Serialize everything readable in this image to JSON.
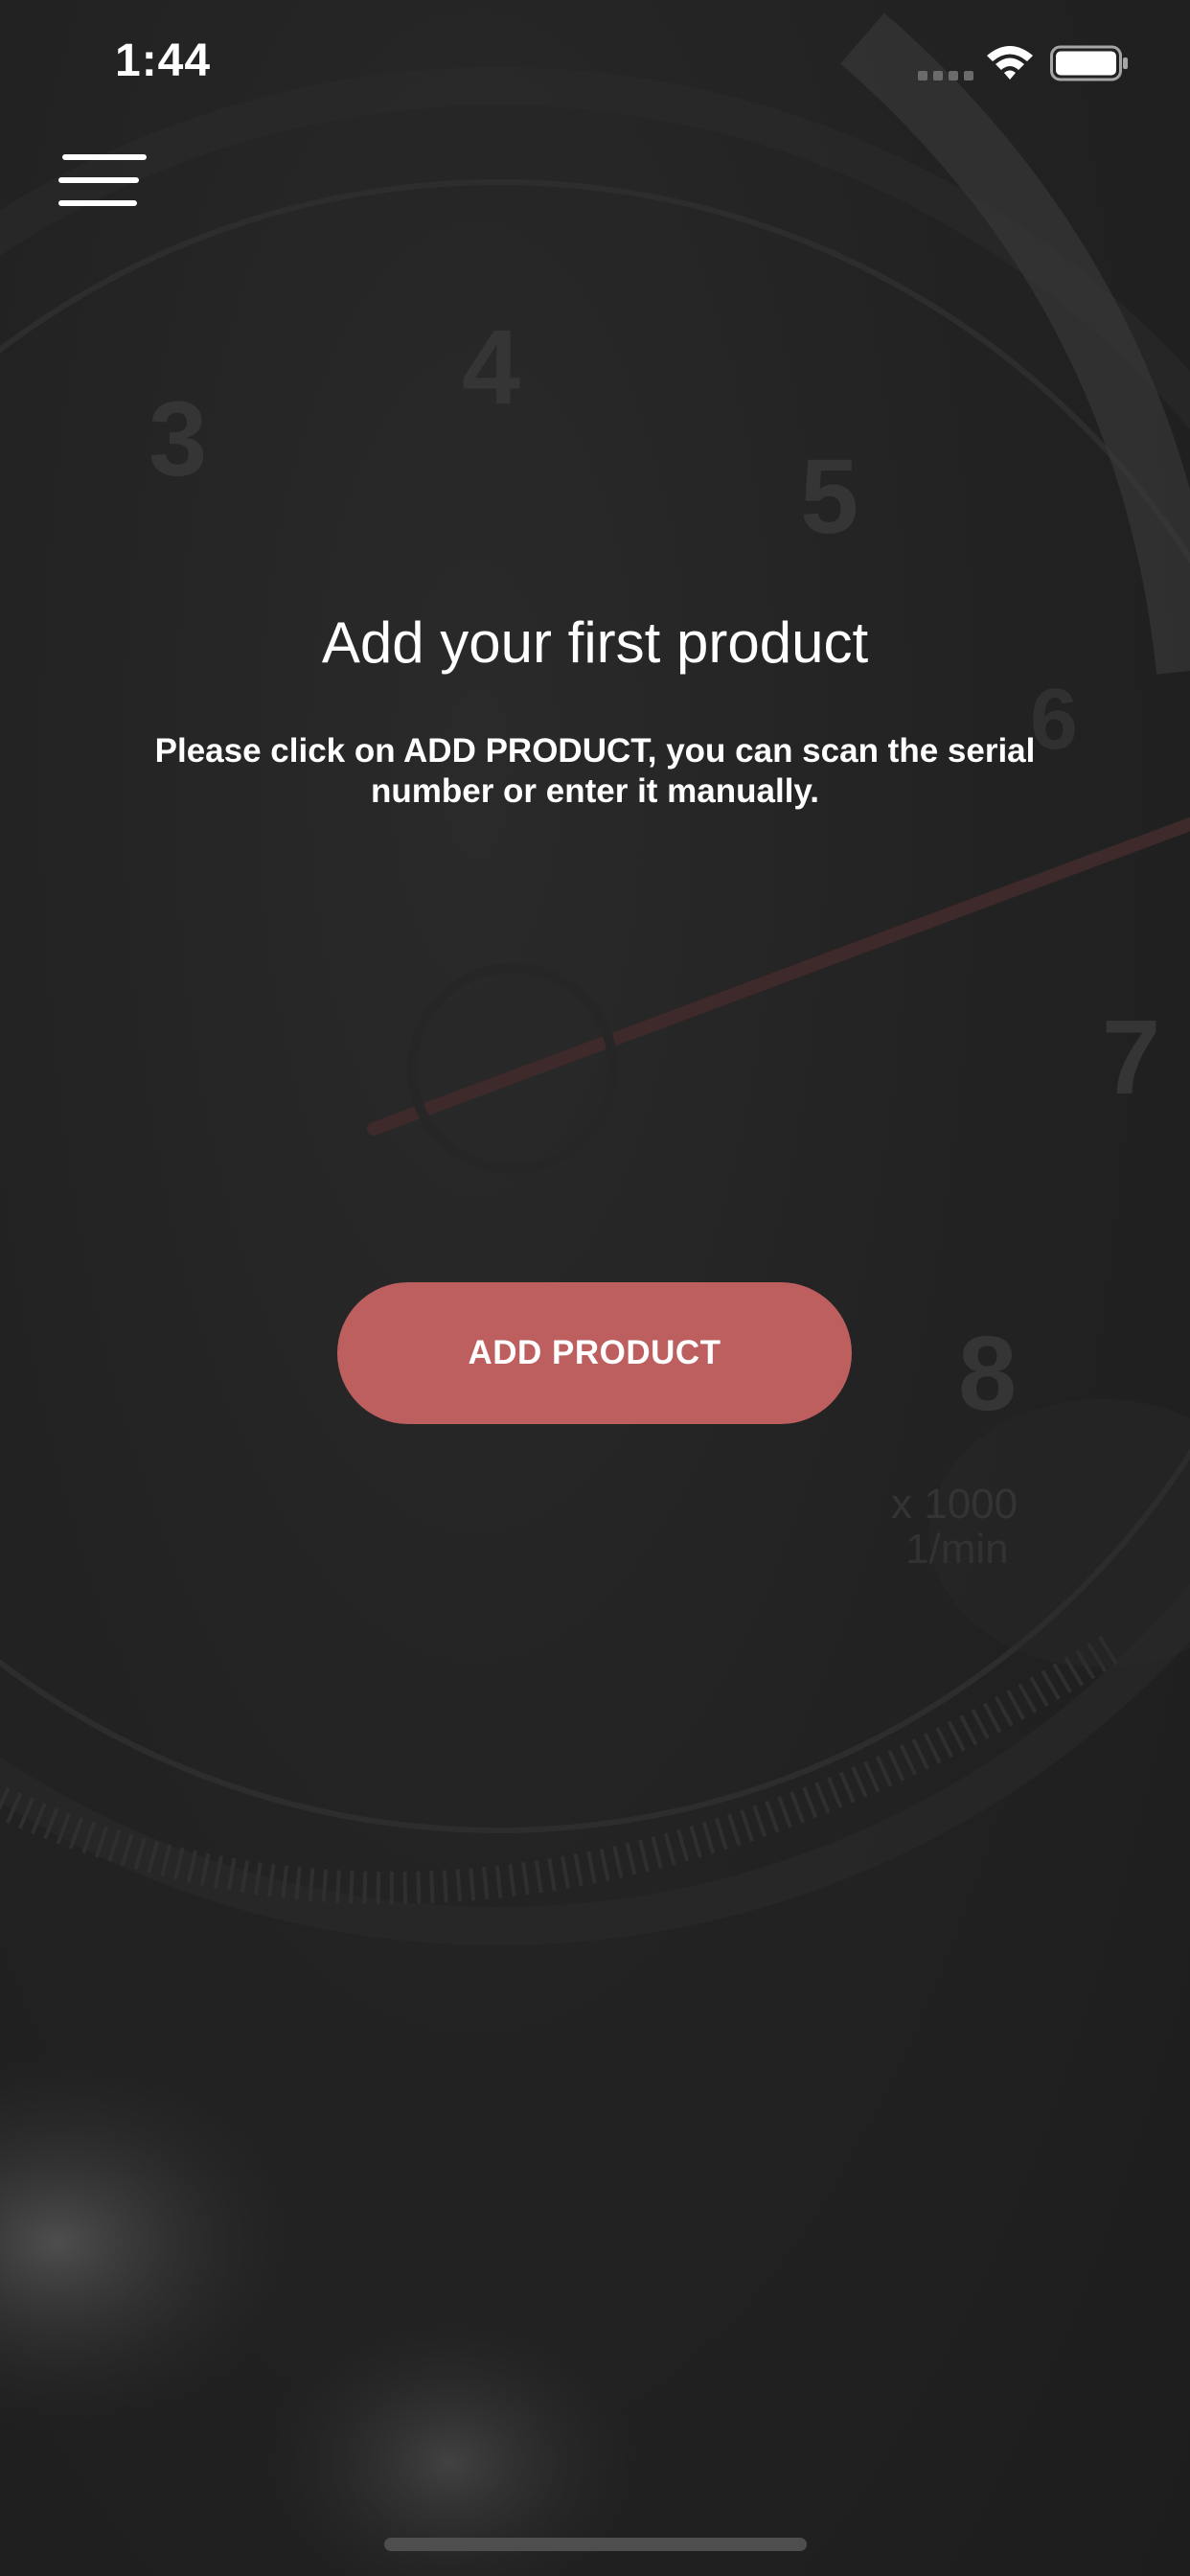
{
  "status_bar": {
    "time": "1:44",
    "icons": [
      "signal-icon",
      "wifi-icon",
      "battery-icon"
    ]
  },
  "menu": {
    "icon": "hamburger-menu-icon"
  },
  "content": {
    "title": "Add your first product",
    "description": "Please click  on ADD PRODUCT, you can scan the serial\nnumber or enter it manually."
  },
  "actions": {
    "add_product_label": "ADD PRODUCT",
    "add_product_color": "#bd5e5f"
  },
  "background": {
    "gauge_numbers": [
      "3",
      "4",
      "5",
      "6",
      "7",
      "8"
    ],
    "gauge_unit_line1": "x 1000",
    "gauge_unit_line2": "1/min"
  }
}
